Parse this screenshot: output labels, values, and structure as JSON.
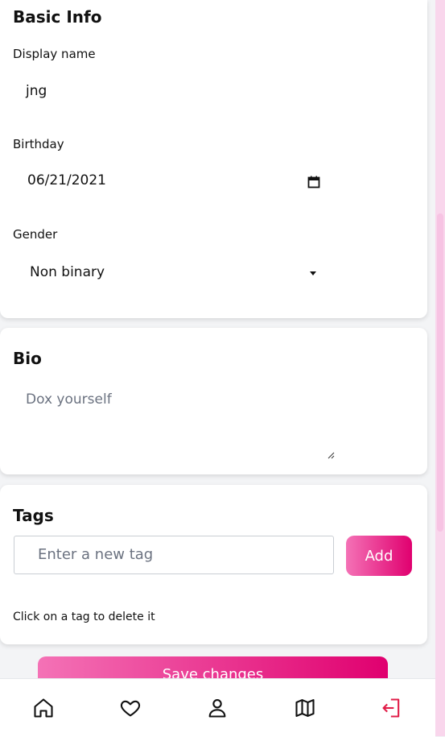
{
  "basic_info": {
    "title": "Basic Info",
    "display_name_label": "Display name",
    "display_name_value": "jng",
    "birthday_label": "Birthday",
    "birthday_value": "06/21/2021",
    "gender_label": "Gender",
    "gender_value": "Non binary"
  },
  "bio": {
    "title": "Bio",
    "placeholder": "Dox yourself"
  },
  "tags": {
    "title": "Tags",
    "input_placeholder": "Enter a new tag",
    "add_label": "Add",
    "hint": "Click on a tag to delete it"
  },
  "actions": {
    "save_label": "Save changes"
  },
  "nav": {
    "items": [
      {
        "icon": "home-icon"
      },
      {
        "icon": "heart-icon"
      },
      {
        "icon": "user-icon"
      },
      {
        "icon": "map-icon"
      },
      {
        "icon": "logout-icon"
      }
    ],
    "logout_color": "#e11d48"
  },
  "colors": {
    "accent_start": "#f472b6",
    "accent_end": "#e0006f"
  }
}
